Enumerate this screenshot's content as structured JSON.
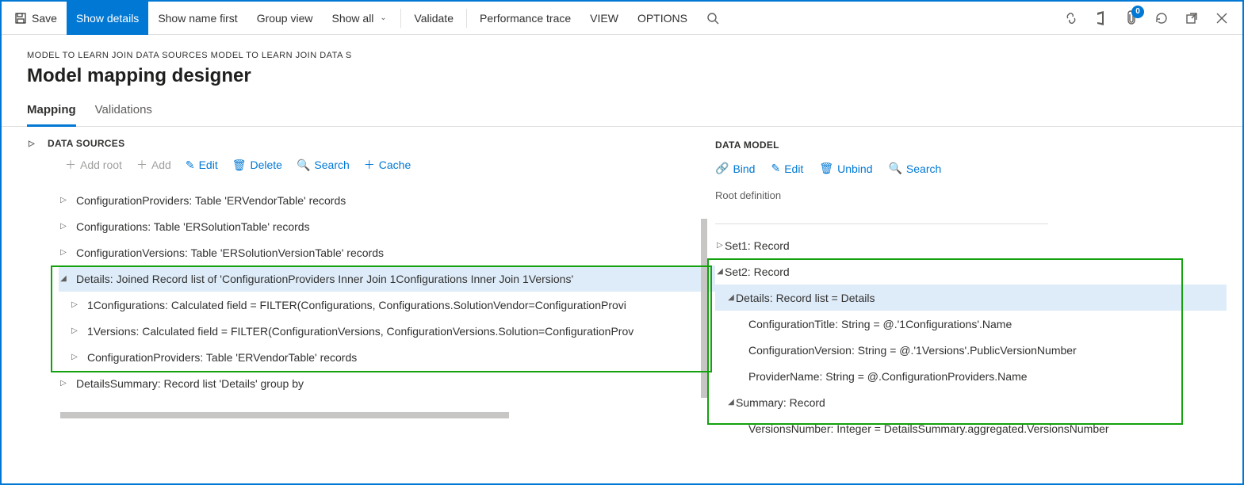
{
  "toolbar": {
    "save": "Save",
    "show_details": "Show details",
    "show_name_first": "Show name first",
    "group_view": "Group view",
    "show_all": "Show all",
    "validate": "Validate",
    "perf_trace": "Performance trace",
    "view": "VIEW",
    "options": "OPTIONS",
    "attach_badge": "0"
  },
  "header": {
    "breadcrumb": "MODEL TO LEARN JOIN DATA SOURCES MODEL TO LEARN JOIN DATA S",
    "title": "Model mapping designer"
  },
  "tabs": {
    "mapping": "Mapping",
    "validations": "Validations"
  },
  "ds": {
    "title": "DATA SOURCES",
    "add_root": "Add root",
    "add": "Add",
    "edit": "Edit",
    "delete": "Delete",
    "search": "Search",
    "cache": "Cache",
    "items": [
      "ConfigurationProviders: Table 'ERVendorTable' records",
      "Configurations: Table 'ERSolutionTable' records",
      "ConfigurationVersions: Table 'ERSolutionVersionTable' records",
      "Details: Joined Record list of 'ConfigurationProviders Inner Join 1Configurations Inner Join 1Versions'",
      "1Configurations: Calculated field = FILTER(Configurations, Configurations.SolutionVendor=ConfigurationProvi",
      "1Versions: Calculated field = FILTER(ConfigurationVersions, ConfigurationVersions.Solution=ConfigurationProv",
      "ConfigurationProviders: Table 'ERVendorTable' records",
      "DetailsSummary: Record list 'Details' group by"
    ]
  },
  "dm": {
    "title": "DATA MODEL",
    "bind": "Bind",
    "edit": "Edit",
    "unbind": "Unbind",
    "search": "Search",
    "root_def": "Root definition",
    "items": [
      "Set1: Record",
      "Set2: Record",
      "Details: Record list = Details",
      "ConfigurationTitle: String = @.'1Configurations'.Name",
      "ConfigurationVersion: String = @.'1Versions'.PublicVersionNumber",
      "ProviderName: String = @.ConfigurationProviders.Name",
      "Summary: Record",
      "VersionsNumber: Integer = DetailsSummary.aggregated.VersionsNumber"
    ]
  }
}
